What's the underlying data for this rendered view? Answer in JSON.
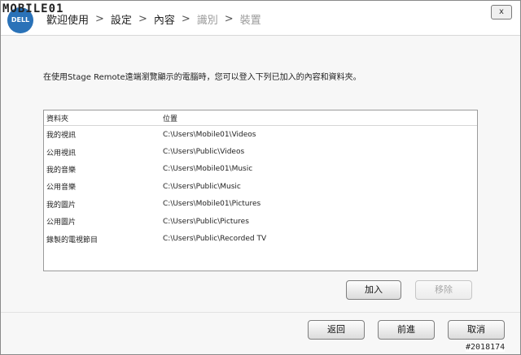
{
  "header": {
    "steps": [
      {
        "label": "歡迎使用",
        "state": "done"
      },
      {
        "label": "設定",
        "state": "done"
      },
      {
        "label": "內容",
        "state": "current"
      },
      {
        "label": "識別",
        "state": "disabled"
      },
      {
        "label": "裝置",
        "state": "disabled"
      }
    ],
    "separator": ">",
    "close_label": "x",
    "logo_text": "DELL",
    "watermark": "MOBILE01"
  },
  "intro_text": "在使用Stage Remote遠端瀏覽顯示的電腦時，您可以登入下列已加入的內容和資料夾。",
  "table": {
    "columns": [
      "資料夾",
      "位置"
    ],
    "rows": [
      {
        "folder": "我的視訊",
        "path": "C:\\Users\\Mobile01\\Videos"
      },
      {
        "folder": "公用視訊",
        "path": "C:\\Users\\Public\\Videos"
      },
      {
        "folder": "我的音樂",
        "path": "C:\\Users\\Mobile01\\Music"
      },
      {
        "folder": "公用音樂",
        "path": "C:\\Users\\Public\\Music"
      },
      {
        "folder": "我的圖片",
        "path": "C:\\Users\\Mobile01\\Pictures"
      },
      {
        "folder": "公用圖片",
        "path": "C:\\Users\\Public\\Pictures"
      },
      {
        "folder": "錄製的電視節目",
        "path": "C:\\Users\\Public\\Recorded TV"
      }
    ]
  },
  "buttons": {
    "add": "加入",
    "remove": "移除",
    "back": "返回",
    "next": "前進",
    "cancel": "取消"
  },
  "credit": "#2018174"
}
